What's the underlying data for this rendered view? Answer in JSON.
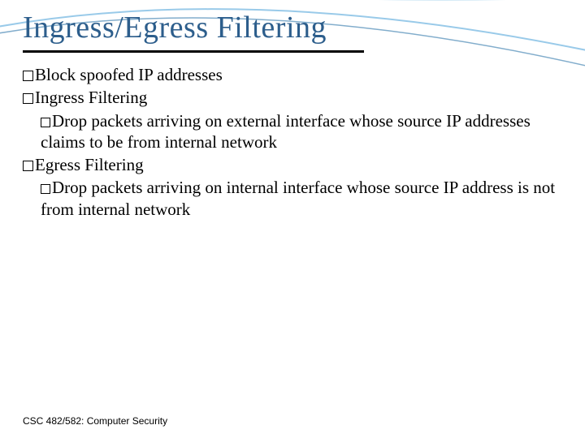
{
  "title": "Ingress/Egress Filtering",
  "bullets": {
    "b1": "Block spoofed IP addresses",
    "b2": "Ingress Filtering",
    "b2_sub": "Drop packets arriving on external interface whose source IP addresses claims to be from internal network",
    "b3": "Egress Filtering",
    "b3_sub": "Drop packets arriving on internal interface whose source IP address is not from internal network"
  },
  "footer": "CSC 482/582: Computer Security"
}
